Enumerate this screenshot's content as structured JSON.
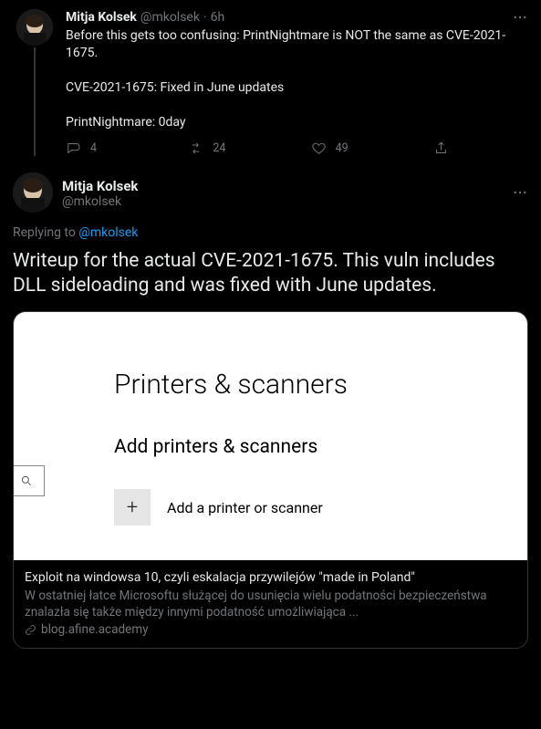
{
  "parent_tweet": {
    "display_name": "Mitja Kolsek",
    "handle": "@mkolsek",
    "separator": "·",
    "time": "6h",
    "text": "Before this gets too confusing: PrintNightmare is NOT the same as CVE-2021-1675.\n\nCVE-2021-1675: Fixed in June updates\n\nPrintNightmare: 0day",
    "reply_count": "4",
    "retweet_count": "24",
    "like_count": "49"
  },
  "detail_tweet": {
    "display_name": "Mitja Kolsek",
    "handle": "@mkolsek",
    "replying_prefix": "Replying to ",
    "replying_handle": "@mkolsek",
    "text": "Writeup for the actual CVE-2021-1675. This vuln includes DLL sideloading and was fixed with June updates."
  },
  "card": {
    "image": {
      "title": "Printers & scanners",
      "subtitle": "Add printers & scanners",
      "add_label": "Add a printer or scanner",
      "plus": "+"
    },
    "title": "Exploit na windowsa 10, czyli eskalacja przywilejów \"made in Poland\"",
    "description": "W ostatniej łatce Microsoftu służącej do usunięcia wielu podatności bezpieczeństwa znalazła się także między innymi podatność umożliwiająca ...",
    "domain": "blog.afine.academy"
  }
}
